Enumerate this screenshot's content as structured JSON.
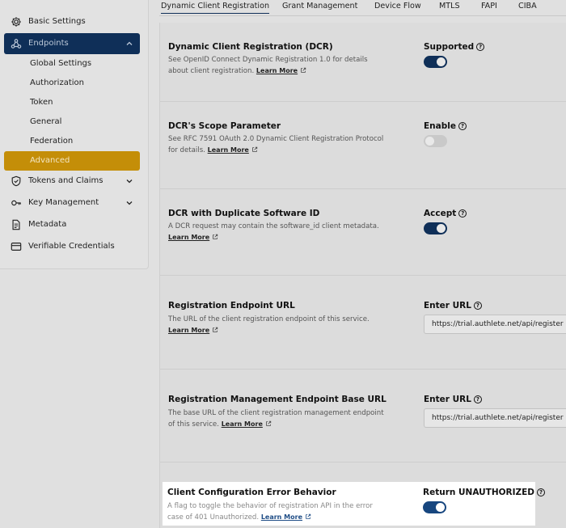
{
  "sidebar": {
    "items": [
      {
        "label": "Basic Settings",
        "icon": "gear-icon"
      },
      {
        "label": "Endpoints",
        "icon": "webhook-icon"
      },
      {
        "label": "Tokens and Claims",
        "icon": "shield-icon"
      },
      {
        "label": "Key Management",
        "icon": "key-icon"
      },
      {
        "label": "Metadata",
        "icon": "document-icon"
      },
      {
        "label": "Verifiable Credentials",
        "icon": "credential-card-icon"
      }
    ],
    "endpoint_subitems": [
      {
        "label": "Global Settings"
      },
      {
        "label": "Authorization"
      },
      {
        "label": "Token"
      },
      {
        "label": "General"
      },
      {
        "label": "Federation"
      },
      {
        "label": "Advanced"
      }
    ]
  },
  "tabs": [
    {
      "label": "Dynamic Client Registration"
    },
    {
      "label": "Grant Management"
    },
    {
      "label": "Device Flow"
    },
    {
      "label": "MTLS"
    },
    {
      "label": "FAPI"
    },
    {
      "label": "CIBA"
    }
  ],
  "settings": [
    {
      "title": "Dynamic Client Registration (DCR)",
      "description": "See OpenID Connect Dynamic Registration 1.0 for details about client registration.",
      "learn_more": "Learn More",
      "control_label": "Supported",
      "toggle_on": true
    },
    {
      "title": "DCR's Scope Parameter",
      "description": "See RFC 7591 OAuth 2.0 Dynamic Client Registration Protocol for details.",
      "learn_more": "Learn More",
      "control_label": "Enable",
      "toggle_on": false
    },
    {
      "title": "DCR with Duplicate Software ID",
      "description": "A DCR request may contain the software_id client metadata.",
      "learn_more": "Learn More",
      "control_label": "Accept",
      "toggle_on": true
    },
    {
      "title": "Registration Endpoint URL",
      "description": "The URL of the client registration endpoint of this service.",
      "learn_more": "Learn More",
      "control_label": "Enter URL",
      "input_value": "https://trial.authlete.net/api/register"
    },
    {
      "title": "Registration Management Endpoint Base URL",
      "description": "The base URL of the client registration management endpoint of this service.",
      "learn_more": "Learn More",
      "control_label": "Enter URL",
      "input_value": "https://trial.authlete.net/api/register"
    },
    {
      "title": "Client Configuration Error Behavior",
      "description": "A flag to toggle the behavior of registration API in the error case of 401 Unauthorized.",
      "learn_more": "Learn More",
      "control_label": "Return UNAUTHORIZED",
      "toggle_on": true
    }
  ],
  "colors": {
    "primary_navy": "#0f2f58",
    "selected_gold": "#c48e08",
    "link_blue": "#1f4d86"
  }
}
